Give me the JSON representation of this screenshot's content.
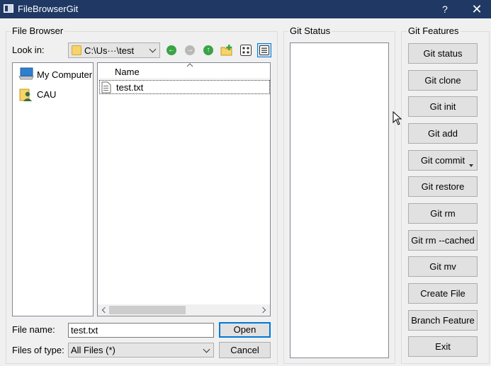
{
  "window": {
    "title": "FileBrowserGit",
    "help_glyph": "?",
    "close_glyph": "✕"
  },
  "file_browser": {
    "group_title": "File Browser",
    "look_in_label": "Look in:",
    "look_in_value": "C:\\Us···\\test",
    "sidebar": [
      {
        "label": "My Computer",
        "icon": "computer-icon"
      },
      {
        "label": "CAU",
        "icon": "user-folder-icon"
      }
    ],
    "column_header": "Name",
    "files": [
      {
        "name": "test.txt",
        "icon": "text-file-icon"
      }
    ],
    "file_name_label": "File name:",
    "file_name_value": "test.txt",
    "files_of_type_label": "Files of type:",
    "files_of_type_value": "All Files (*)",
    "open_label": "Open",
    "cancel_label": "Cancel"
  },
  "git_status": {
    "group_title": "Git Status"
  },
  "git_features": {
    "group_title": "Git Features",
    "buttons": [
      "Git status",
      "Git clone",
      "Git init",
      "Git add",
      "Git commit",
      "Git restore",
      "Git rm",
      "Git rm --cached",
      "Git mv",
      "Create File",
      "Branch Feature",
      "Exit"
    ]
  },
  "colors": {
    "titlebar": "#1f3864",
    "accent": "#0078d7",
    "back_green": "#3aa346",
    "up_green": "#3aa346"
  }
}
